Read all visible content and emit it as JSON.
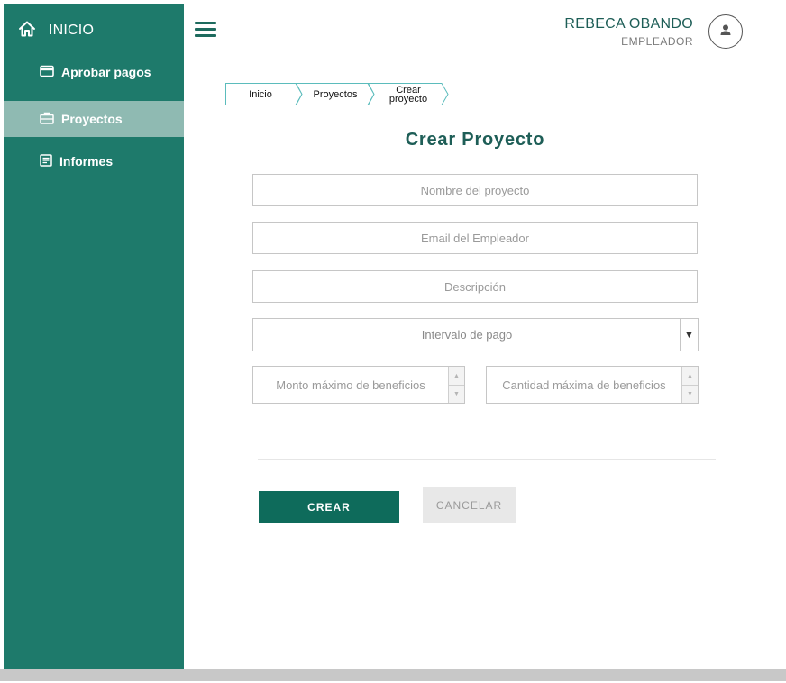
{
  "sidebar": {
    "home_label": "INICIO",
    "items": [
      {
        "label": "Aprobar pagos",
        "icon": "credit-card-icon",
        "active": false
      },
      {
        "label": "Proyectos",
        "icon": "briefcase-icon",
        "active": true
      },
      {
        "label": "Informes",
        "icon": "document-icon",
        "active": false
      }
    ]
  },
  "header": {
    "menu_icon": "hamburger-icon",
    "user_name": "REBECA OBANDO",
    "user_role": "EMPLEADOR",
    "avatar_icon": "user-icon"
  },
  "breadcrumb": {
    "items": [
      "Inicio",
      "Proyectos",
      "Crear\nproyecto"
    ]
  },
  "form": {
    "title": "Crear Proyecto",
    "project_name_placeholder": "Nombre del proyecto",
    "employer_email_placeholder": "Email del Empleador",
    "description_placeholder": "Descripción",
    "payment_interval_placeholder": "Intervalo de pago",
    "max_amount_placeholder": "Monto máximo de beneficios",
    "max_quantity_placeholder": "Cantidad máxima de beneficios",
    "create_label": "CREAR",
    "cancel_label": "CANCELAR"
  },
  "colors": {
    "sidebar_bg": "#1e7a6b",
    "sidebar_active": "#8fbab2",
    "accent": "#1e5e57",
    "primary_button": "#0e6b5b",
    "breadcrumb_border": "#5bbcbc"
  }
}
